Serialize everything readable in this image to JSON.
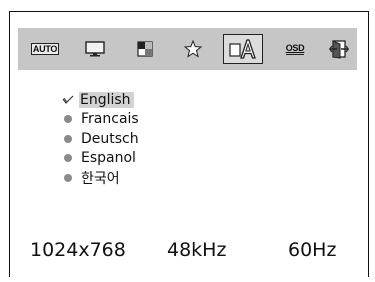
{
  "toolbar": {
    "auto_label": "AUTO",
    "osd_label": "OSD",
    "icons": [
      "auto-icon",
      "monitor-icon",
      "color-icon",
      "star-icon",
      "language-icon",
      "osd-icon",
      "exit-icon"
    ]
  },
  "languages": [
    {
      "label": "English",
      "selected": true
    },
    {
      "label": "Francais",
      "selected": false
    },
    {
      "label": "Deutsch",
      "selected": false
    },
    {
      "label": "Espanol",
      "selected": false
    },
    {
      "label": "한국어",
      "selected": false
    }
  ],
  "status": {
    "resolution": "1024x768",
    "h_freq": "48kHz",
    "v_freq": "60Hz"
  }
}
